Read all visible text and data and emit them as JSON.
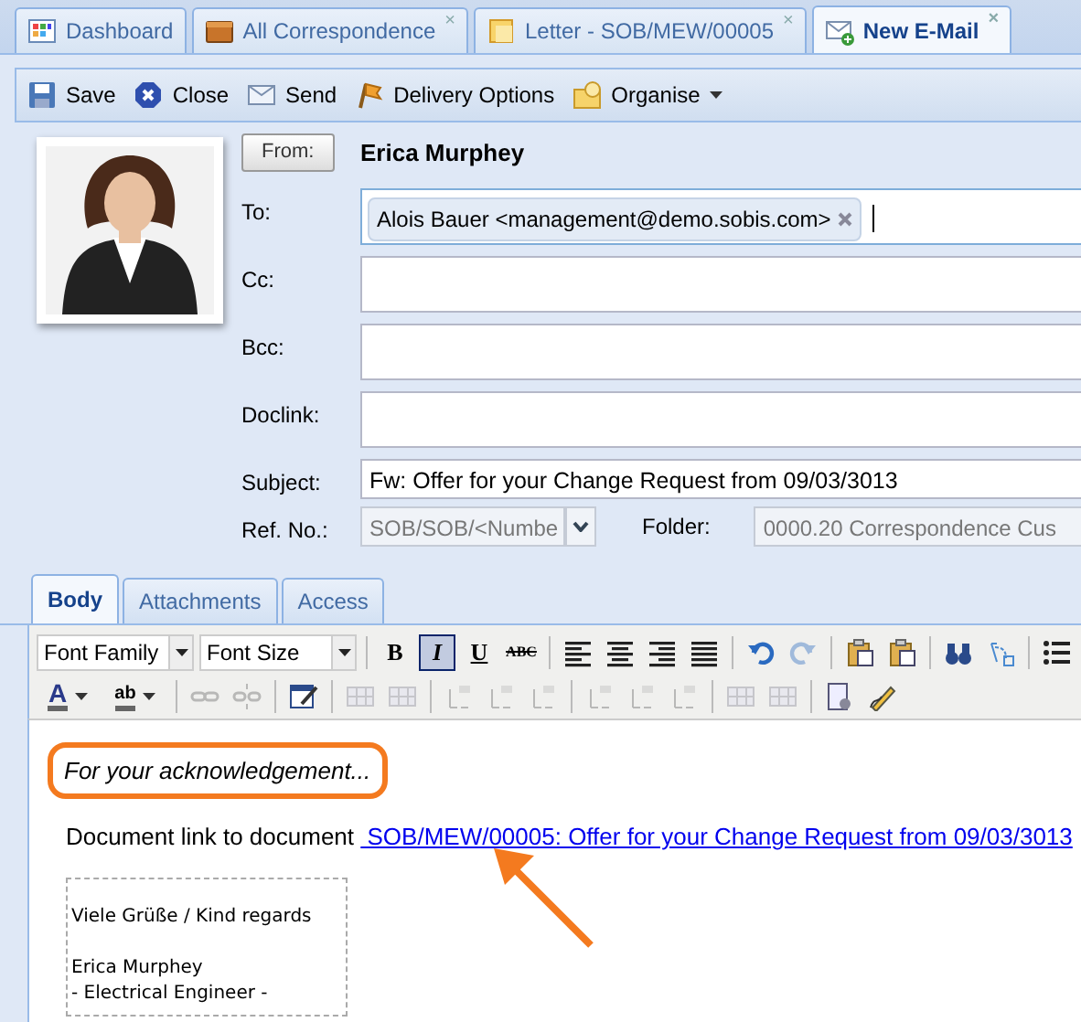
{
  "tabs": [
    {
      "label": "Dashboard",
      "closable": false,
      "selected": false
    },
    {
      "label": "All Correspondence",
      "closable": true,
      "selected": false
    },
    {
      "label": "Letter - SOB/MEW/00005",
      "closable": true,
      "selected": false
    },
    {
      "label": "New E-Mail",
      "closable": true,
      "selected": true
    }
  ],
  "close_glyph": "×",
  "toolbar": [
    {
      "label": "Save",
      "dropdown": false
    },
    {
      "label": "Close",
      "dropdown": false
    },
    {
      "label": "Send",
      "dropdown": false
    },
    {
      "label": "Delivery Options",
      "dropdown": false
    },
    {
      "label": "Organise",
      "dropdown": true
    }
  ],
  "from": {
    "button": "From:",
    "name": "Erica Murphey"
  },
  "fields": [
    {
      "label": "To:",
      "kind": "recipients",
      "focused": true,
      "tokens": [
        "Alois Bauer <management@demo.sobis.com>"
      ]
    },
    {
      "label": "Cc:",
      "kind": "recipients",
      "focused": false
    },
    {
      "label": "Bcc:",
      "kind": "recipients",
      "focused": false
    },
    {
      "label": "Doclink:",
      "kind": "recipients",
      "focused": false
    },
    {
      "label": "Subject:",
      "kind": "text",
      "focused": false,
      "value": "Fw: Offer for your Change Request from 09/03/3013"
    }
  ],
  "ref": {
    "label": "Ref. No.:",
    "value": "SOB/SOB/<Numbe",
    "folder_label": "Folder:",
    "folder_value": "0000.20 Correspondence Cus"
  },
  "body_tabs": [
    {
      "label": "Body",
      "selected": true
    },
    {
      "label": "Attachments",
      "selected": false
    },
    {
      "label": "Access",
      "selected": false
    }
  ],
  "editor_rows": [
    [
      {
        "kind": "select",
        "text": "Font Family"
      },
      {
        "kind": "select",
        "text": "Font Size"
      },
      {
        "kind": "separator"
      },
      {
        "kind": "text-button",
        "text": "B",
        "selected": false
      },
      {
        "kind": "text-button",
        "text": "I",
        "selected": true
      },
      {
        "kind": "text-button",
        "text": "U",
        "selected": false
      },
      {
        "kind": "text-button",
        "text": "ABC",
        "selected": false
      },
      {
        "kind": "separator"
      },
      {
        "kind": "button",
        "disabled": false
      },
      {
        "kind": "button",
        "disabled": false
      },
      {
        "kind": "button",
        "disabled": false
      },
      {
        "kind": "button",
        "disabled": false
      },
      {
        "kind": "separator"
      },
      {
        "kind": "button",
        "disabled": false
      },
      {
        "kind": "button",
        "disabled": true
      },
      {
        "kind": "separator"
      },
      {
        "kind": "button",
        "disabled": false
      },
      {
        "kind": "button",
        "disabled": false
      },
      {
        "kind": "separator"
      },
      {
        "kind": "button",
        "disabled": false
      },
      {
        "kind": "button",
        "disabled": false
      },
      {
        "kind": "separator"
      },
      {
        "kind": "button",
        "disabled": false
      }
    ],
    [
      {
        "kind": "color-button",
        "text": "A"
      },
      {
        "kind": "color-button",
        "text": "ab"
      },
      {
        "kind": "separator"
      },
      {
        "kind": "button",
        "disabled": true
      },
      {
        "kind": "button",
        "disabled": true
      },
      {
        "kind": "separator"
      },
      {
        "kind": "button",
        "disabled": false
      },
      {
        "kind": "separator"
      },
      {
        "kind": "button",
        "disabled": true
      },
      {
        "kind": "button",
        "disabled": true
      },
      {
        "kind": "separator"
      },
      {
        "kind": "button",
        "disabled": true
      },
      {
        "kind": "button",
        "disabled": true
      },
      {
        "kind": "button",
        "disabled": true
      },
      {
        "kind": "separator"
      },
      {
        "kind": "button",
        "disabled": true
      },
      {
        "kind": "button",
        "disabled": true
      },
      {
        "kind": "button",
        "disabled": true
      },
      {
        "kind": "separator"
      },
      {
        "kind": "button",
        "disabled": true
      },
      {
        "kind": "button",
        "disabled": true
      },
      {
        "kind": "separator"
      },
      {
        "kind": "button",
        "disabled": false
      },
      {
        "kind": "button",
        "disabled": false
      }
    ]
  ],
  "content": {
    "note": {
      "text": "For your acknowledgement...",
      "highlighted": true
    },
    "link_line": {
      "text": "Document link to document ",
      "link": " SOB/MEW/00005: Offer for your Change Request from 09/03/3013",
      "arrow": true
    },
    "signature": [
      [
        "Viele Grüße / Kind regards"
      ],
      [
        "Erica Murphey",
        "- Electrical Engineer -"
      ]
    ]
  }
}
